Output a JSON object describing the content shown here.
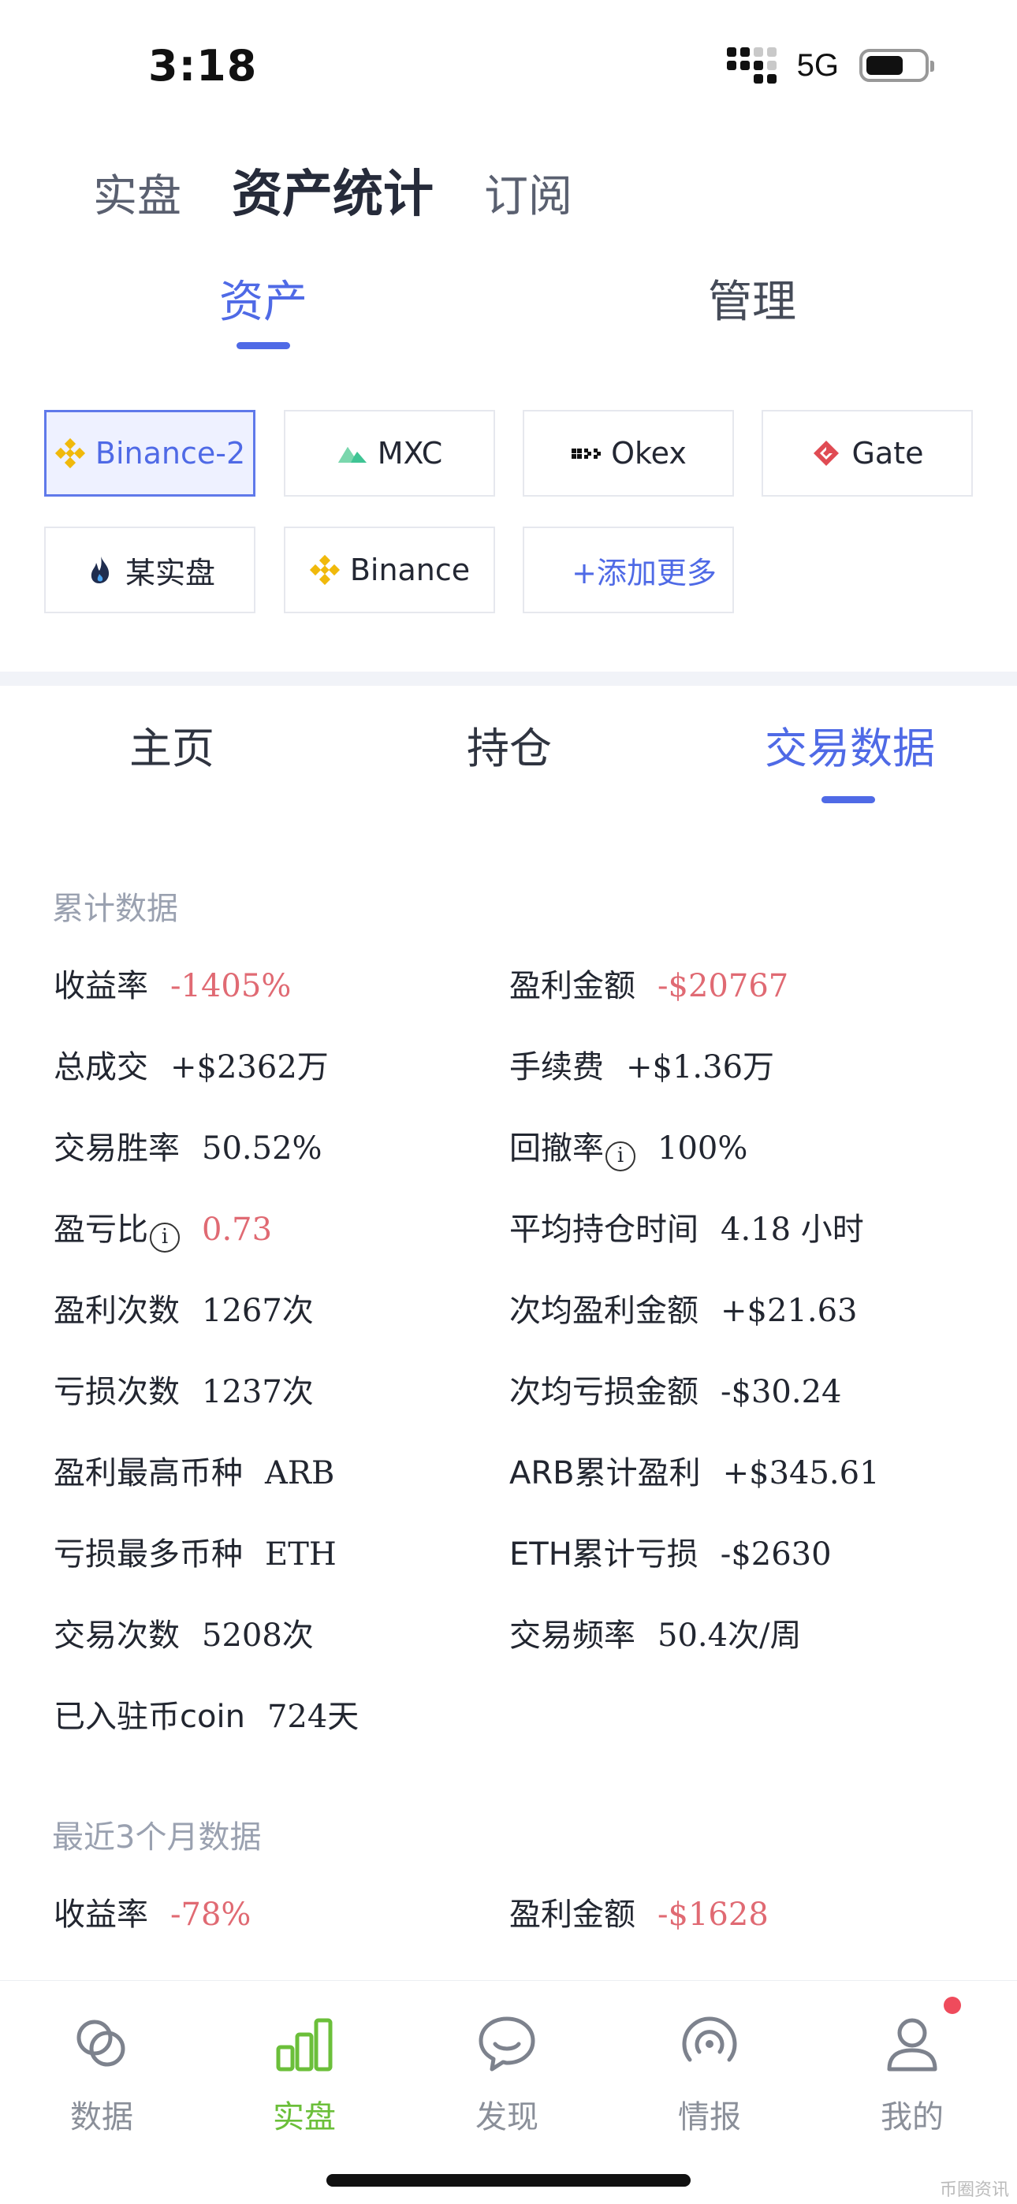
{
  "status_bar": {
    "time": "3:18",
    "network": "5G"
  },
  "top_tabs": [
    {
      "label": "实盘",
      "active": false
    },
    {
      "label": "资产统计",
      "active": true
    },
    {
      "label": "订阅",
      "active": false
    }
  ],
  "sub_tabs": [
    {
      "label": "资产",
      "active": true
    },
    {
      "label": "管理",
      "active": false
    }
  ],
  "exchanges": [
    {
      "label": "Binance-2",
      "icon": "binance-icon",
      "selected": true
    },
    {
      "label": "MXC",
      "icon": "mxc-icon",
      "selected": false
    },
    {
      "label": "Okex",
      "icon": "okex-icon",
      "selected": false
    },
    {
      "label": "Gate",
      "icon": "gate-icon",
      "selected": false
    },
    {
      "label": "某实盘",
      "icon": "flame-icon",
      "selected": false
    },
    {
      "label": "Binance",
      "icon": "binance-icon",
      "selected": false
    }
  ],
  "add_more": "+添加更多",
  "section_tabs": [
    {
      "label": "主页",
      "active": false
    },
    {
      "label": "持仓",
      "active": false
    },
    {
      "label": "交易数据",
      "active": true
    }
  ],
  "cumulative": {
    "title": "累计数据",
    "rows": [
      [
        {
          "label": "收益率",
          "value": "-1405%",
          "negative": true
        },
        {
          "label": "盈利金额",
          "value": "-$20767",
          "negative": true
        }
      ],
      [
        {
          "label": "总成交",
          "value": "+$2362万",
          "negative": false
        },
        {
          "label": "手续费",
          "value": "+$1.36万",
          "negative": false
        }
      ],
      [
        {
          "label": "交易胜率",
          "value": "50.52%",
          "negative": false
        },
        {
          "label": "回撤率",
          "value": "100%",
          "negative": false,
          "info": true
        }
      ],
      [
        {
          "label": "盈亏比",
          "value": "0.73",
          "negative": true,
          "info": true
        },
        {
          "label": "平均持仓时间",
          "value": "4.18 小时",
          "negative": false
        }
      ],
      [
        {
          "label": "盈利次数",
          "value": "1267次",
          "negative": false
        },
        {
          "label": "次均盈利金额",
          "value": "+$21.63",
          "negative": false
        }
      ],
      [
        {
          "label": "亏损次数",
          "value": "1237次",
          "negative": false
        },
        {
          "label": "次均亏损金额",
          "value": "-$30.24",
          "negative": false
        }
      ],
      [
        {
          "label": "盈利最高币种",
          "value": "ARB",
          "negative": false
        },
        {
          "label": "ARB累计盈利",
          "value": "+$345.61",
          "negative": false
        }
      ],
      [
        {
          "label": "亏损最多币种",
          "value": "ETH",
          "negative": false
        },
        {
          "label": "ETH累计亏损",
          "value": "-$2630",
          "negative": false
        }
      ],
      [
        {
          "label": "交易次数",
          "value": "5208次",
          "negative": false
        },
        {
          "label": "交易频率",
          "value": "50.4次/周",
          "negative": false
        }
      ],
      [
        {
          "label": "已入驻币coin",
          "value": "724天",
          "negative": false
        }
      ]
    ]
  },
  "recent": {
    "title": "最近3个月数据",
    "rows": [
      [
        {
          "label": "收益率",
          "value": "-78%",
          "negative": true
        },
        {
          "label": "盈利金额",
          "value": "-$1628",
          "negative": true
        }
      ]
    ]
  },
  "tabbar": [
    {
      "label": "数据",
      "icon": "data-icon",
      "active": false
    },
    {
      "label": "实盘",
      "icon": "bar-chart-icon",
      "active": true
    },
    {
      "label": "发现",
      "icon": "chat-bubble-icon",
      "active": false
    },
    {
      "label": "情报",
      "icon": "broadcast-icon",
      "active": false
    },
    {
      "label": "我的",
      "icon": "profile-icon",
      "active": false,
      "badge": true
    }
  ],
  "watermark": "币圈资讯"
}
